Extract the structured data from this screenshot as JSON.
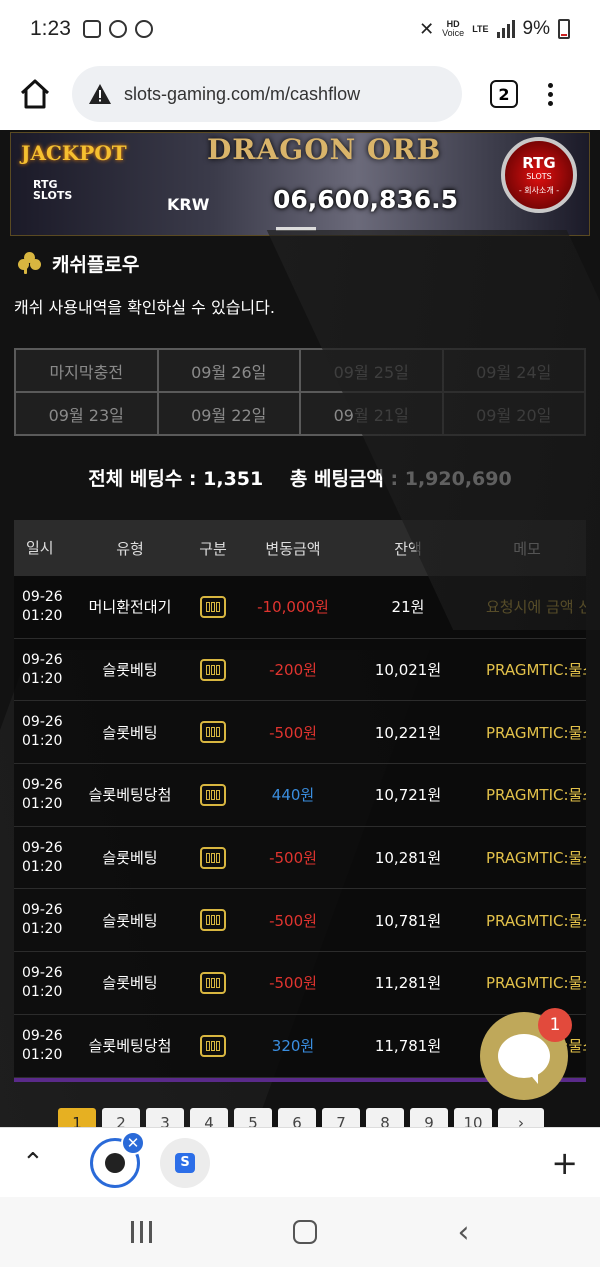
{
  "status": {
    "time": "1:23",
    "battery": "9%",
    "hd_label": "HD",
    "voice_label": "Voice",
    "lte_label": "LTE"
  },
  "browser": {
    "url": "slots-gaming.com/m/cashflow",
    "tab_count": "2"
  },
  "banner": {
    "jackpot_label": "JACKPOT",
    "rtg_label": "RTG",
    "slots_label": "SLOTS",
    "game_title": "DRAGON ORB",
    "currency": "KRW",
    "amount": "06,600,836.5",
    "badge_title": "RTG",
    "badge_sub": "SLOTS",
    "badge_text": "- 회사소개 -"
  },
  "page": {
    "title": "캐쉬플로우",
    "subtitle": "캐쉬 사용내역을 확인하실 수 있습니다."
  },
  "date_filters": [
    "마지막충전",
    "09월 26일",
    "09월 25일",
    "09월 24일",
    "09월 23일",
    "09월 22일",
    "09월 21일",
    "09월 20일"
  ],
  "totals": {
    "bet_count": "전체 베팅수 : 1,351",
    "bet_amount": "총 베팅금액 : 1,920,690"
  },
  "table": {
    "headers": [
      "일시",
      "유형",
      "구분",
      "변동금액",
      "잔액",
      "메모"
    ],
    "rows": [
      {
        "date": "09-26",
        "time": "01:20",
        "type": "머니환전대기",
        "change": "-10,000원",
        "balance": "21원",
        "memo": "요청시에 금액 선"
      },
      {
        "date": "09-26",
        "time": "01:20",
        "type": "슬롯베팅",
        "change": "-200원",
        "balance": "10,021원",
        "memo": "PRAGMTIC:물소"
      },
      {
        "date": "09-26",
        "time": "01:20",
        "type": "슬롯베팅",
        "change": "-500원",
        "balance": "10,221원",
        "memo": "PRAGMTIC:물소"
      },
      {
        "date": "09-26",
        "time": "01:20",
        "type": "슬롯베팅당첨",
        "change": "440원",
        "balance": "10,721원",
        "memo": "PRAGMTIC:물소"
      },
      {
        "date": "09-26",
        "time": "01:20",
        "type": "슬롯베팅",
        "change": "-500원",
        "balance": "10,281원",
        "memo": "PRAGMTIC:물소"
      },
      {
        "date": "09-26",
        "time": "01:20",
        "type": "슬롯베팅",
        "change": "-500원",
        "balance": "10,781원",
        "memo": "PRAGMTIC:물소"
      },
      {
        "date": "09-26",
        "time": "01:20",
        "type": "슬롯베팅",
        "change": "-500원",
        "balance": "11,281원",
        "memo": "PRAGMTIC:물소"
      },
      {
        "date": "09-26",
        "time": "01:20",
        "type": "슬롯베팅당첨",
        "change": "320원",
        "balance": "11,781원",
        "memo": "PRAGMTIC:물소"
      }
    ]
  },
  "pagination": [
    "1",
    "2",
    "3",
    "4",
    "5",
    "6",
    "7",
    "8",
    "9",
    "10",
    "›"
  ],
  "chat": {
    "badge": "1"
  },
  "colors": {
    "accent": "#e6b022",
    "negative": "#e0342f",
    "positive": "#3a8ee0",
    "memo": "#e2c14a"
  }
}
